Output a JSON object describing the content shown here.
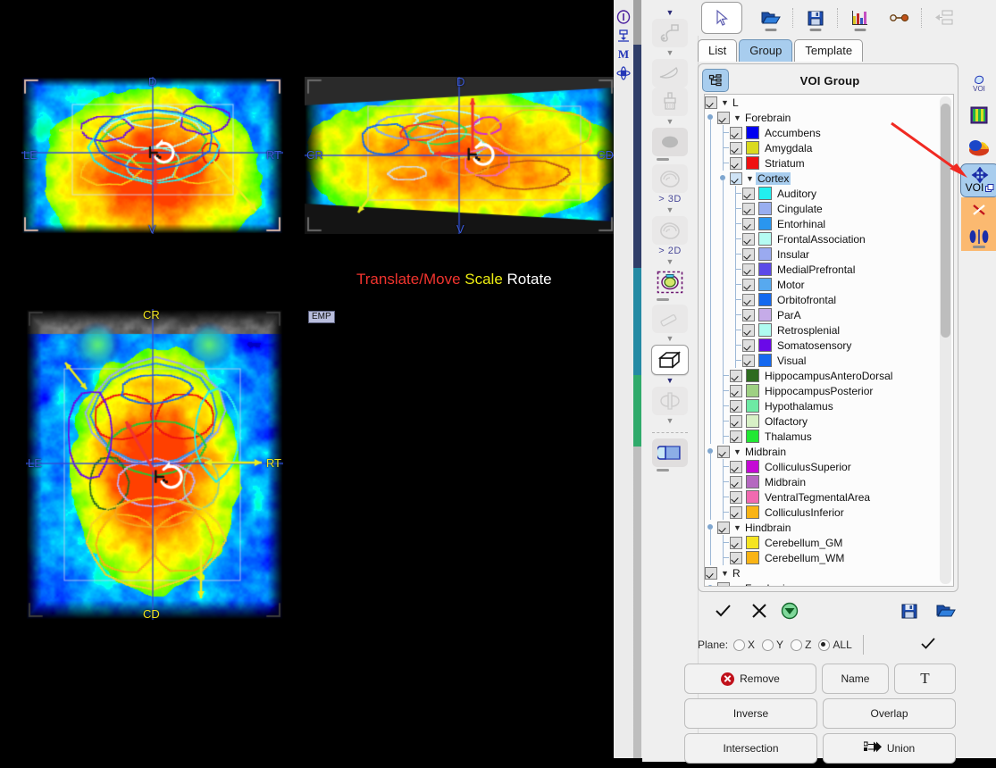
{
  "window": {
    "left_rail_icons": [
      "info-icon",
      "anchor-icon",
      "m-icon",
      "atom-icon"
    ]
  },
  "top_toolbar": {
    "items": [
      {
        "name": "pointer-tool",
        "icon": "cursor-icon",
        "selected": true
      },
      {
        "name": "open-folder",
        "icon": "folder-open-icon",
        "selected": false
      },
      {
        "name": "save",
        "icon": "floppy-disk-icon",
        "selected": false
      },
      {
        "name": "statistics",
        "icon": "bar-chart-icon",
        "selected": false
      },
      {
        "name": "link",
        "icon": "link-icon",
        "selected": false
      },
      {
        "name": "layout",
        "icon": "layout-icon",
        "selected": false
      }
    ]
  },
  "tool_column": {
    "items": [
      {
        "name": "wrench-tool",
        "icon": "wrench-icon",
        "state": "disabled"
      },
      {
        "name": "knife-tool",
        "icon": "scalpel-icon",
        "state": "disabled"
      },
      {
        "name": "brush-tool",
        "icon": "brush-icon",
        "state": "disabled"
      },
      {
        "name": "blob-tool",
        "icon": "blob-icon",
        "state": "flat"
      },
      {
        "name": "segment-3d-tool",
        "icon": "segment-icon",
        "state": "disabled",
        "label": "> 3D"
      },
      {
        "name": "segment-2d-tool",
        "icon": "segment-icon",
        "state": "disabled",
        "label": "> 2D"
      },
      {
        "name": "marker-tool",
        "icon": "target-marker-icon",
        "state": "active"
      },
      {
        "name": "eraser-tool",
        "icon": "eraser-icon",
        "state": "disabled"
      },
      {
        "name": "box-tool",
        "icon": "cube-icon",
        "state": "selected"
      },
      {
        "name": "axe-tool",
        "icon": "axe-icon",
        "state": "disabled"
      },
      {
        "name": "ruler-tool",
        "icon": "ruler-icon",
        "state": "flat"
      }
    ],
    "label_3d": "> 3D",
    "label_2d": "> 2D"
  },
  "tabs": [
    {
      "label": "List",
      "active": false
    },
    {
      "label": "Group",
      "active": true
    },
    {
      "label": "Template",
      "active": false
    }
  ],
  "voi_panel": {
    "title": "VOI Group",
    "header_button": "tree-outline-icon",
    "tree": [
      {
        "depth": 0,
        "label": "L",
        "checked": true,
        "expander": "▼",
        "color": null,
        "selected": false
      },
      {
        "depth": 1,
        "label": "Forebrain",
        "checked": true,
        "expander": "▼",
        "color": null,
        "selected": false
      },
      {
        "depth": 2,
        "label": "Accumbens",
        "checked": true,
        "expander": null,
        "color": "#0000f0",
        "selected": false
      },
      {
        "depth": 2,
        "label": "Amygdala",
        "checked": true,
        "expander": null,
        "color": "#dada1e",
        "selected": false
      },
      {
        "depth": 2,
        "label": "Striatum",
        "checked": true,
        "expander": null,
        "color": "#f01010",
        "selected": false
      },
      {
        "depth": 2,
        "label": "Cortex",
        "checked": true,
        "expander": "▼",
        "color": null,
        "selected": true
      },
      {
        "depth": 3,
        "label": "Auditory",
        "checked": true,
        "expander": null,
        "color": "#22efef",
        "selected": false
      },
      {
        "depth": 3,
        "label": "Cingulate",
        "checked": true,
        "expander": null,
        "color": "#99aef0",
        "selected": false
      },
      {
        "depth": 3,
        "label": "Entorhinal",
        "checked": true,
        "expander": null,
        "color": "#2a96ef",
        "selected": false
      },
      {
        "depth": 3,
        "label": "FrontalAssociation",
        "checked": true,
        "expander": null,
        "color": "#b5fbf2",
        "selected": false
      },
      {
        "depth": 3,
        "label": "Insular",
        "checked": true,
        "expander": null,
        "color": "#9aaaf0",
        "selected": false
      },
      {
        "depth": 3,
        "label": "MedialPrefrontal",
        "checked": true,
        "expander": null,
        "color": "#5b4ae8",
        "selected": false
      },
      {
        "depth": 3,
        "label": "Motor",
        "checked": true,
        "expander": null,
        "color": "#57a9ef",
        "selected": false
      },
      {
        "depth": 3,
        "label": "Orbitofrontal",
        "checked": true,
        "expander": null,
        "color": "#1469ef",
        "selected": false
      },
      {
        "depth": 3,
        "label": "ParA",
        "checked": true,
        "expander": null,
        "color": "#c5abe8",
        "selected": false
      },
      {
        "depth": 3,
        "label": "Retrosplenial",
        "checked": true,
        "expander": null,
        "color": "#affbf0",
        "selected": false
      },
      {
        "depth": 3,
        "label": "Somatosensory",
        "checked": true,
        "expander": null,
        "color": "#6a09e8",
        "selected": false
      },
      {
        "depth": 3,
        "label": "Visual",
        "checked": true,
        "expander": null,
        "color": "#1468f0",
        "selected": false
      },
      {
        "depth": 2,
        "label": "HippocampusAnteroDorsal",
        "checked": true,
        "expander": null,
        "color": "#2d6b1f",
        "selected": false
      },
      {
        "depth": 2,
        "label": "HippocampusPosterior",
        "checked": true,
        "expander": null,
        "color": "#9ed083",
        "selected": false
      },
      {
        "depth": 2,
        "label": "Hypothalamus",
        "checked": true,
        "expander": null,
        "color": "#6deaa4",
        "selected": false
      },
      {
        "depth": 2,
        "label": "Olfactory",
        "checked": true,
        "expander": null,
        "color": "#d7f0c6",
        "selected": false
      },
      {
        "depth": 2,
        "label": "Thalamus",
        "checked": true,
        "expander": null,
        "color": "#22e833",
        "selected": false
      },
      {
        "depth": 1,
        "label": "Midbrain",
        "checked": true,
        "expander": "▼",
        "color": null,
        "selected": false
      },
      {
        "depth": 2,
        "label": "ColliculusSuperior",
        "checked": true,
        "expander": null,
        "color": "#c40ad4",
        "selected": false
      },
      {
        "depth": 2,
        "label": "Midbrain",
        "checked": true,
        "expander": null,
        "color": "#b568c0",
        "selected": false
      },
      {
        "depth": 2,
        "label": "VentralTegmentalArea",
        "checked": true,
        "expander": null,
        "color": "#f16ab0",
        "selected": false
      },
      {
        "depth": 2,
        "label": "ColliculusInferior",
        "checked": true,
        "expander": null,
        "color": "#f9b415",
        "selected": false
      },
      {
        "depth": 1,
        "label": "Hindbrain",
        "checked": true,
        "expander": "▼",
        "color": null,
        "selected": false
      },
      {
        "depth": 2,
        "label": "Cerebellum_GM",
        "checked": true,
        "expander": null,
        "color": "#f5e422",
        "selected": false
      },
      {
        "depth": 2,
        "label": "Cerebellum_WM",
        "checked": true,
        "expander": null,
        "color": "#f9b415",
        "selected": false
      },
      {
        "depth": 0,
        "label": "R",
        "checked": true,
        "expander": "▼",
        "color": null,
        "selected": false
      },
      {
        "depth": 1,
        "label": "Forebrain",
        "checked": true,
        "expander": "▼",
        "color": null,
        "selected": false
      }
    ]
  },
  "right_icons": [
    {
      "name": "voi-icon",
      "caption": "VOI"
    },
    {
      "name": "colormap-icon",
      "caption": ""
    },
    {
      "name": "brain-render-icon",
      "caption": ""
    },
    {
      "name": "voi-move-icon",
      "caption": "VOI"
    },
    {
      "name": "voi-cut-icon",
      "caption": ""
    },
    {
      "name": "voi-mirror-icon",
      "caption": ""
    }
  ],
  "action_row": [
    {
      "name": "confirm-check-button",
      "icon": "check-icon"
    },
    {
      "name": "cancel-x-button",
      "icon": "x-icon"
    },
    {
      "name": "download-green-button",
      "icon": "download-circle-icon"
    },
    {
      "name": "save-button",
      "icon": "floppy-disk-icon"
    },
    {
      "name": "open-button",
      "icon": "folder-open-icon"
    }
  ],
  "plane_row": {
    "label": "Plane:",
    "options": [
      {
        "label": "X",
        "selected": false
      },
      {
        "label": "Y",
        "selected": false
      },
      {
        "label": "Z",
        "selected": false
      },
      {
        "label": "ALL",
        "selected": true
      }
    ],
    "apply_icon": "check-icon"
  },
  "bottom_buttons": [
    {
      "name": "remove-button",
      "label": "Remove",
      "icon": "x-circle-icon"
    },
    {
      "name": "name-button",
      "label": "Name",
      "icon": null
    },
    {
      "name": "text-button",
      "label": "T",
      "icon": null
    },
    {
      "name": "inverse-button",
      "label": "Inverse",
      "icon": null
    },
    {
      "name": "overlap-button",
      "label": "Overlap",
      "icon": null
    },
    {
      "name": "intersection-button",
      "label": "Intersection",
      "icon": null
    },
    {
      "name": "union-button",
      "label": "Union",
      "icon": "union-icon"
    }
  ],
  "viewer": {
    "mode_legend": {
      "translate": "Translate/Move",
      "scale": "Scale",
      "rotate": "Rotate",
      "translate_color": "#f1342e",
      "scale_color": "#ecec12",
      "rotate_color": "#ffffff"
    },
    "emp_badge": "EMP",
    "slices": [
      {
        "name": "coronal-view",
        "labels": {
          "top": "D",
          "bottom": "V",
          "left": "LE",
          "right": "RT"
        }
      },
      {
        "name": "sagittal-view",
        "labels": {
          "top": "D",
          "bottom": "V",
          "left": "CR",
          "right": "CD"
        }
      },
      {
        "name": "axial-view",
        "labels": {
          "top": "CR",
          "bottom": "CD",
          "left": "LE",
          "right": "RT"
        }
      }
    ]
  }
}
